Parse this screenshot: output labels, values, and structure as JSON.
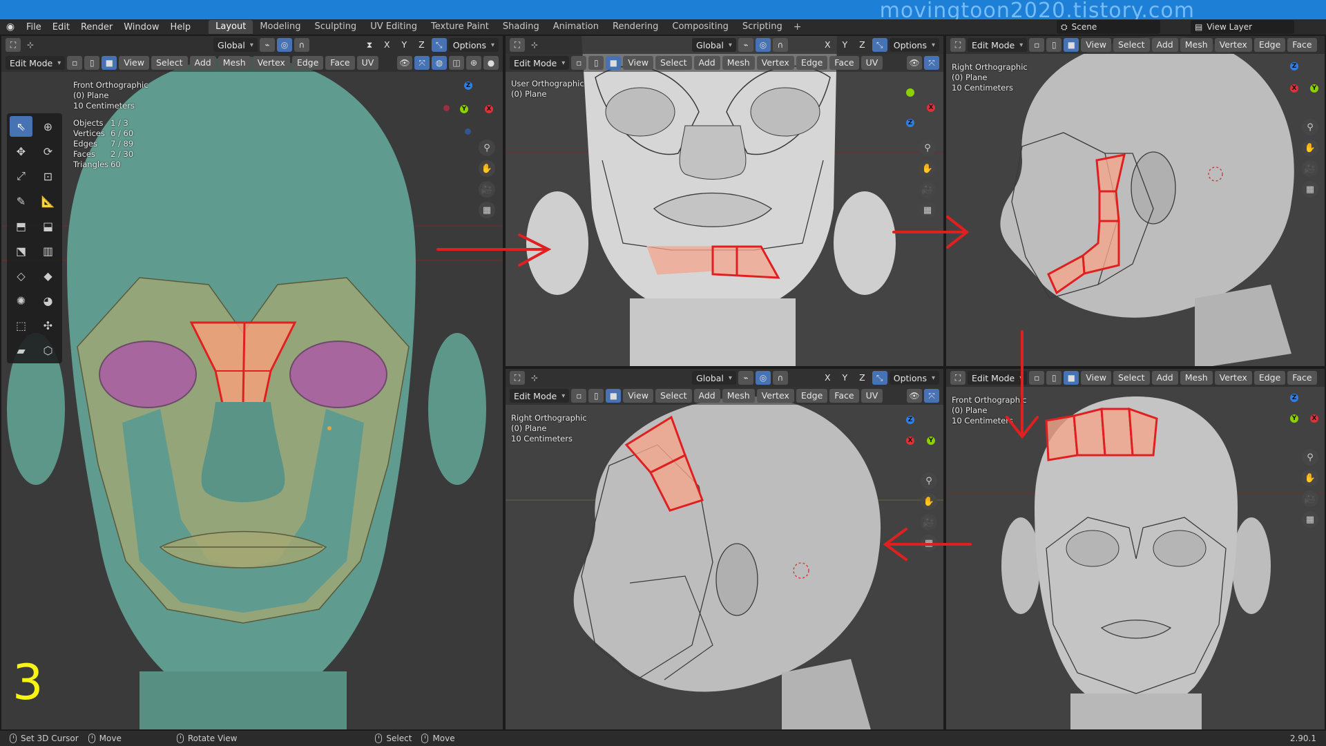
{
  "watermark": "movingtoon2020.tistory.com",
  "menubar": {
    "items": [
      "File",
      "Edit",
      "Render",
      "Window",
      "Help"
    ],
    "tabs": [
      "Layout",
      "Modeling",
      "Sculpting",
      "UV Editing",
      "Texture Paint",
      "Shading",
      "Animation",
      "Rendering",
      "Compositing",
      "Scripting"
    ],
    "active_tab": "Layout",
    "scene": "Scene",
    "view_layer": "View Layer"
  },
  "header": {
    "transform": "Global",
    "options": "Options",
    "axes": [
      "X",
      "Y",
      "Z"
    ],
    "mode": "Edit Mode",
    "menus": [
      "View",
      "Select",
      "Add",
      "Mesh",
      "Vertex",
      "Edge",
      "Face",
      "UV"
    ]
  },
  "viewports": {
    "main": {
      "view_name": "Front Orthographic",
      "object": "(0) Plane",
      "scale": "10 Centimeters",
      "stats": [
        {
          "label": "Objects",
          "value": "1 / 3"
        },
        {
          "label": "Vertices",
          "value": "6 / 60"
        },
        {
          "label": "Edges",
          "value": "7 / 89"
        },
        {
          "label": "Faces",
          "value": "2 / 30"
        },
        {
          "label": "Triangles",
          "value": "60"
        }
      ],
      "step_number": "3"
    },
    "top_mid": {
      "view_name": "User Orthographic",
      "object": "(0) Plane"
    },
    "top_right": {
      "view_name": "Right Orthographic",
      "object": "(0) Plane",
      "scale": "10 Centimeters"
    },
    "bottom_mid": {
      "view_name": "Right Orthographic",
      "object": "(0) Plane",
      "scale": "10 Centimeters"
    },
    "bottom_right": {
      "view_name": "Front Orthographic",
      "object": "(0) Plane",
      "scale": "10 Centimeters"
    }
  },
  "statusbar": {
    "items": [
      "Set 3D Cursor",
      "Move",
      "Rotate View",
      "Select",
      "Move"
    ],
    "version": "2.90.1"
  },
  "colors": {
    "accent": "#4772b3",
    "topstrip": "#1e7fd6",
    "head_main": "#5f9b8e",
    "head_gray": "#bdbdbd",
    "selection": "#e02020",
    "step_number": "#f7f312"
  }
}
